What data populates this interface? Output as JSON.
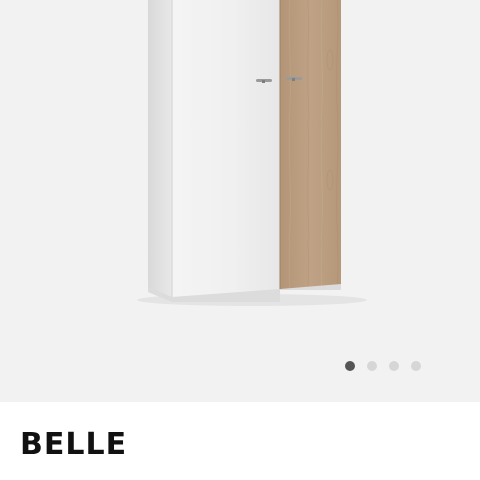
{
  "product": {
    "name": "BELLE"
  },
  "gallery": {
    "image_count": 4,
    "active_index": 0
  },
  "colors": {
    "gallery_background": "#f2f2f2",
    "cabinet_white": "#f3f3f3",
    "cabinet_oak": "#b89a7b",
    "dot_active": "#555555",
    "dot_inactive": "#d6d6d6"
  },
  "icons": [
    "product-image",
    "pagination-dot"
  ]
}
